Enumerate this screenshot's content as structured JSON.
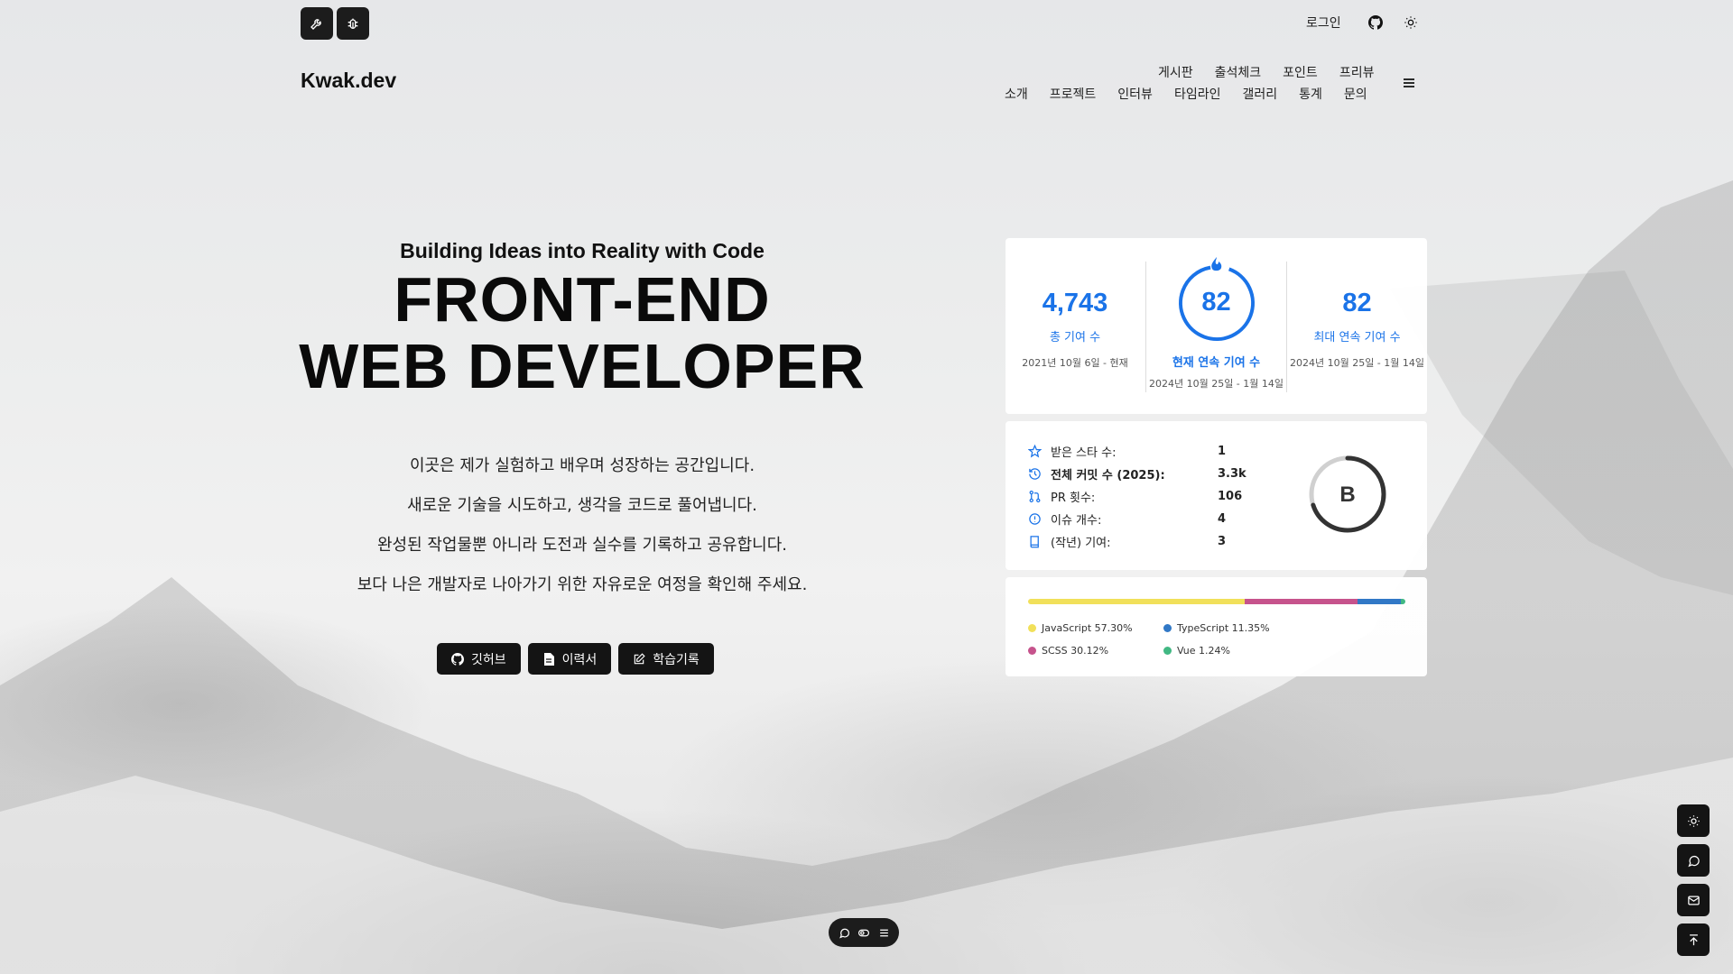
{
  "header": {
    "brand": "Kwak.dev",
    "login": "로그인",
    "nav_row1": [
      "게시판",
      "출석체크",
      "포인트",
      "프리뷰"
    ],
    "nav_row2": [
      "소개",
      "프로젝트",
      "인터뷰",
      "타임라인",
      "갤러리",
      "통계",
      "문의"
    ]
  },
  "hero": {
    "subtitle": "Building Ideas into Reality with Code",
    "title_line1": "FRONT-END",
    "title_line2": "WEB DEVELOPER",
    "desc": [
      "이곳은 제가 실험하고 배우며 성장하는 공간입니다.",
      "새로운 기술을 시도하고, 생각을 코드로 풀어냅니다.",
      "완성된 작업물뿐 아니라 도전과 실수를 기록하고 공유합니다.",
      "보다 나은 개발자로 나아가기 위한 자유로운 여정을 확인해 주세요."
    ],
    "buttons": [
      "깃허브",
      "이력서",
      "학습기록"
    ]
  },
  "streak": {
    "total": {
      "value": "4,743",
      "label": "총 기여 수",
      "date": "2021년 10월 6일 - 현재"
    },
    "current": {
      "value": "82",
      "label": "현재 연속 기여 수",
      "date": "2024년 10월 25일 - 1월 14일"
    },
    "longest": {
      "value": "82",
      "label": "최대 연속 기여 수",
      "date": "2024년 10월 25일 - 1월 14일"
    },
    "accent_color": "#1a73e8"
  },
  "github_stats": {
    "rows": [
      {
        "label": "받은 스타 수:",
        "value": "1",
        "icon": "star-icon"
      },
      {
        "label": "전체 커밋 수 (2025):",
        "value": "3.3k",
        "icon": "history-icon"
      },
      {
        "label": "PR 횟수:",
        "value": "106",
        "icon": "pull-request-icon"
      },
      {
        "label": "이슈 개수:",
        "value": "4",
        "icon": "issue-icon"
      },
      {
        "label": "(작년) 기여:",
        "value": "3",
        "icon": "repo-icon"
      }
    ],
    "rank": "B",
    "rank_progress": 0.7
  },
  "languages": {
    "items": [
      {
        "name": "JavaScript",
        "percent_label": "57.30%",
        "percent": 57.3,
        "color": "#f1e05a"
      },
      {
        "name": "SCSS",
        "percent_label": "30.12%",
        "percent": 30.12,
        "color": "#c6538c"
      },
      {
        "name": "TypeScript",
        "percent_label": "11.35%",
        "percent": 11.35,
        "color": "#3178c6"
      },
      {
        "name": "Vue",
        "percent_label": "1.24%",
        "percent": 1.24,
        "color": "#41b883"
      }
    ]
  }
}
